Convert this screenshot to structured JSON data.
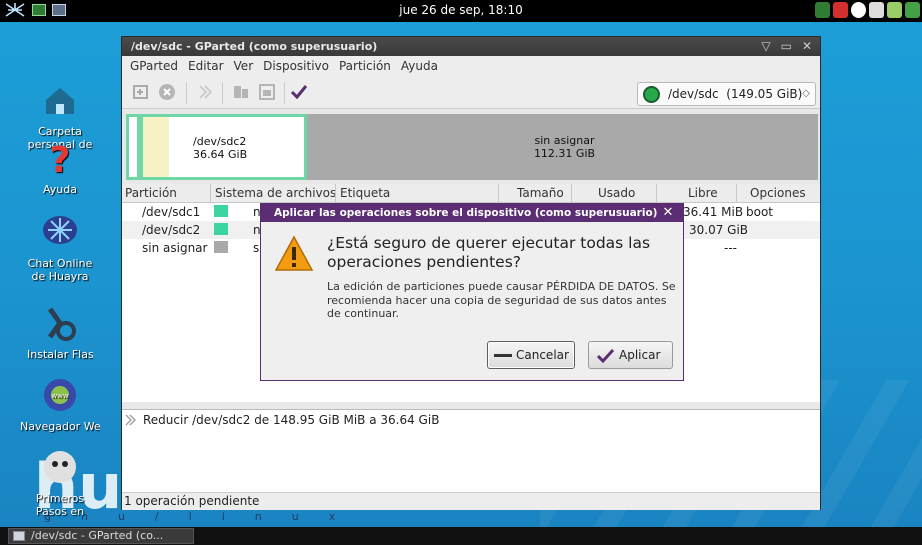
{
  "top_panel": {
    "clock": "jue 26 de sep, 18:10",
    "icons": [
      "huayra-menu-icon",
      "window-icon",
      "monitor-icon"
    ],
    "tray_icons": [
      "battery-icon",
      "mail-icon",
      "accessibility-icon",
      "volume-icon",
      "network-icon",
      "keyboard-icon"
    ]
  },
  "desktop": {
    "icons": [
      {
        "label": "Carpeta personal de alumno",
        "icon": "home-folder-icon"
      },
      {
        "label": "Ayuda",
        "icon": "help-icon"
      },
      {
        "label": "Chat Online de Huayra",
        "icon": "chat-icon"
      },
      {
        "label": "Instalar Flash Player",
        "icon": "install-flash-icon"
      },
      {
        "label": "Navegador Web",
        "icon": "browser-icon"
      },
      {
        "label": "Primeros Pasos en Huayra",
        "icon": "first-steps-icon"
      }
    ],
    "brand": "hua",
    "tagline": "gnu/linux"
  },
  "window": {
    "title": "/dev/sdc - GParted (como superusuario)",
    "menu": [
      "GParted",
      "Editar",
      "Ver",
      "Dispositivo",
      "Partición",
      "Ayuda"
    ],
    "device_selector": "/dev/sdc  (149.05 GiB)",
    "graphic": {
      "sdc2_name": "/dev/sdc2",
      "sdc2_size": "36.64 GiB",
      "unallocated_name": "sin asignar",
      "unallocated_size": "112.31 GiB"
    },
    "columns": [
      "Partición",
      "Sistema de archivos",
      "Etiqueta",
      "Tamaño",
      "Usado",
      "Libre",
      "Opciones"
    ],
    "rows": [
      {
        "partition": "/dev/sdc1",
        "fs": "nt",
        "free": "36.41 MiB",
        "flags": "boot",
        "color": "#3ad5a0"
      },
      {
        "partition": "/dev/sdc2",
        "fs": "nt",
        "free": "30.07 GiB",
        "flags": "",
        "color": "#3ad5a0"
      },
      {
        "partition": "sin asignar",
        "fs": "si",
        "free": "---",
        "flags": "",
        "color": "#a9a9a9"
      }
    ],
    "pending_operation": "Reducir /dev/sdc2 de 148.95 GiB MiB a 36.64 GiB",
    "status": "1 operación pendiente"
  },
  "dialog": {
    "title": "Aplicar las operaciones sobre el dispositivo (como superusuario)",
    "heading": "¿Está seguro de querer ejecutar todas las operaciones pendientes?",
    "text": "La edición de particiones puede causar PÉRDIDA DE DATOS. Se recomienda hacer una copia de seguridad de sus datos antes de continuar.",
    "cancel_label": "Cancelar",
    "apply_label": "Aplicar"
  },
  "taskbar": {
    "task_label": "/dev/sdc - GParted (co..."
  },
  "colors": {
    "accent": "#5b2d72",
    "partition_border": "#6fd7a5",
    "desktop": "#1d9fd8"
  }
}
